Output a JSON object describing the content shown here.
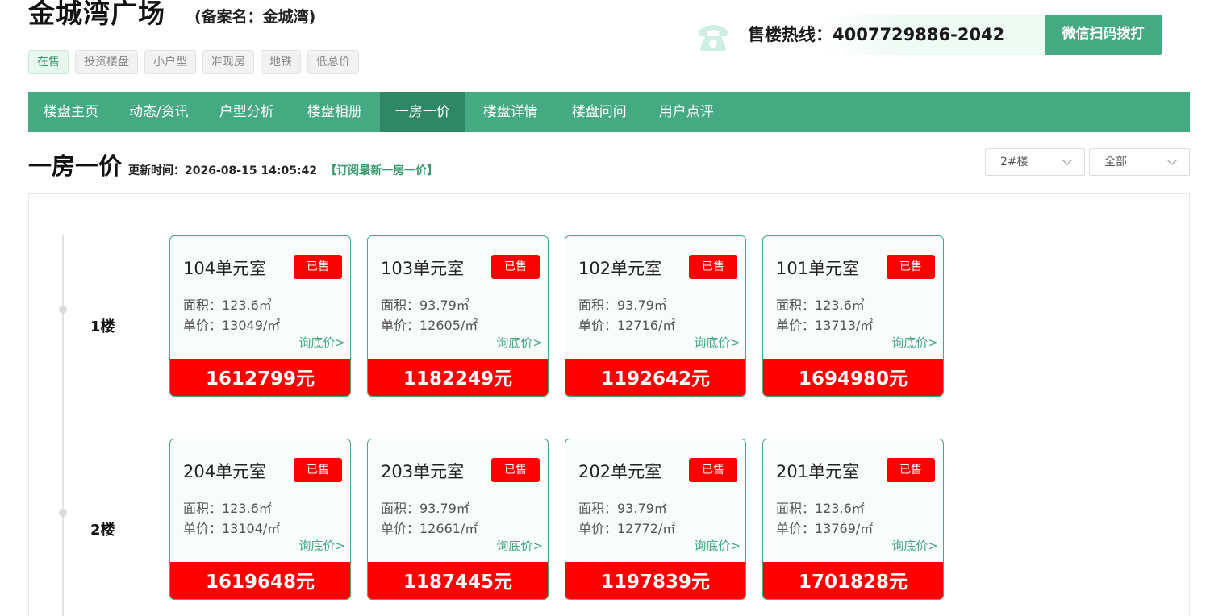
{
  "header": {
    "title": "金城湾广场",
    "alias": "(备案名：金城湾)",
    "tags": [
      {
        "label": "在售",
        "active": true
      },
      {
        "label": "投资楼盘",
        "active": false
      },
      {
        "label": "小户型",
        "active": false
      },
      {
        "label": "准现房",
        "active": false
      },
      {
        "label": "地铁",
        "active": false
      },
      {
        "label": "低总价",
        "active": false
      }
    ],
    "hotline": "售楼热线：4007729886-2042",
    "phone_icon": "phone-icon",
    "wechat_button": "微信扫码拨打"
  },
  "nav": {
    "items": [
      {
        "label": "楼盘主页",
        "active": false
      },
      {
        "label": "动态/资讯",
        "active": false
      },
      {
        "label": "户型分析",
        "active": false
      },
      {
        "label": "楼盘相册",
        "active": false
      },
      {
        "label": "一房一价",
        "active": true
      },
      {
        "label": "楼盘详情",
        "active": false
      },
      {
        "label": "楼盘问问",
        "active": false
      },
      {
        "label": "用户点评",
        "active": false
      }
    ]
  },
  "section": {
    "title": "一房一价",
    "update_time": "更新时间：2026-08-15 14:05:42",
    "subscribe": "【订阅最新一房一价】",
    "building_select": "2#楼",
    "filter_select": "全部"
  },
  "floors": [
    {
      "label": "1楼",
      "units": [
        {
          "room": "104单元室",
          "status": "已售",
          "area": "面积：123.6㎡",
          "unit_price": "单价：13049/㎡",
          "ask": "询底价>",
          "total": "1612799元"
        },
        {
          "room": "103单元室",
          "status": "已售",
          "area": "面积：93.79㎡",
          "unit_price": "单价：12605/㎡",
          "ask": "询底价>",
          "total": "1182249元"
        },
        {
          "room": "102单元室",
          "status": "已售",
          "area": "面积：93.79㎡",
          "unit_price": "单价：12716/㎡",
          "ask": "询底价>",
          "total": "1192642元"
        },
        {
          "room": "101单元室",
          "status": "已售",
          "area": "面积：123.6㎡",
          "unit_price": "单价：13713/㎡",
          "ask": "询底价>",
          "total": "1694980元"
        }
      ]
    },
    {
      "label": "2楼",
      "units": [
        {
          "room": "204单元室",
          "status": "已售",
          "area": "面积：123.6㎡",
          "unit_price": "单价：13104/㎡",
          "ask": "询底价>",
          "total": "1619648元"
        },
        {
          "room": "203单元室",
          "status": "已售",
          "area": "面积：93.79㎡",
          "unit_price": "单价：12661/㎡",
          "ask": "询底价>",
          "total": "1187445元"
        },
        {
          "room": "202单元室",
          "status": "已售",
          "area": "面积：93.79㎡",
          "unit_price": "单价：12772/㎡",
          "ask": "询底价>",
          "total": "1197839元"
        },
        {
          "room": "201单元室",
          "status": "已售",
          "area": "面积：123.6㎡",
          "unit_price": "单价：13769/㎡",
          "ask": "询底价>",
          "total": "1701828元"
        }
      ]
    }
  ],
  "colors": {
    "brand_green": "#45a982",
    "sold_red": "#ff0000"
  }
}
